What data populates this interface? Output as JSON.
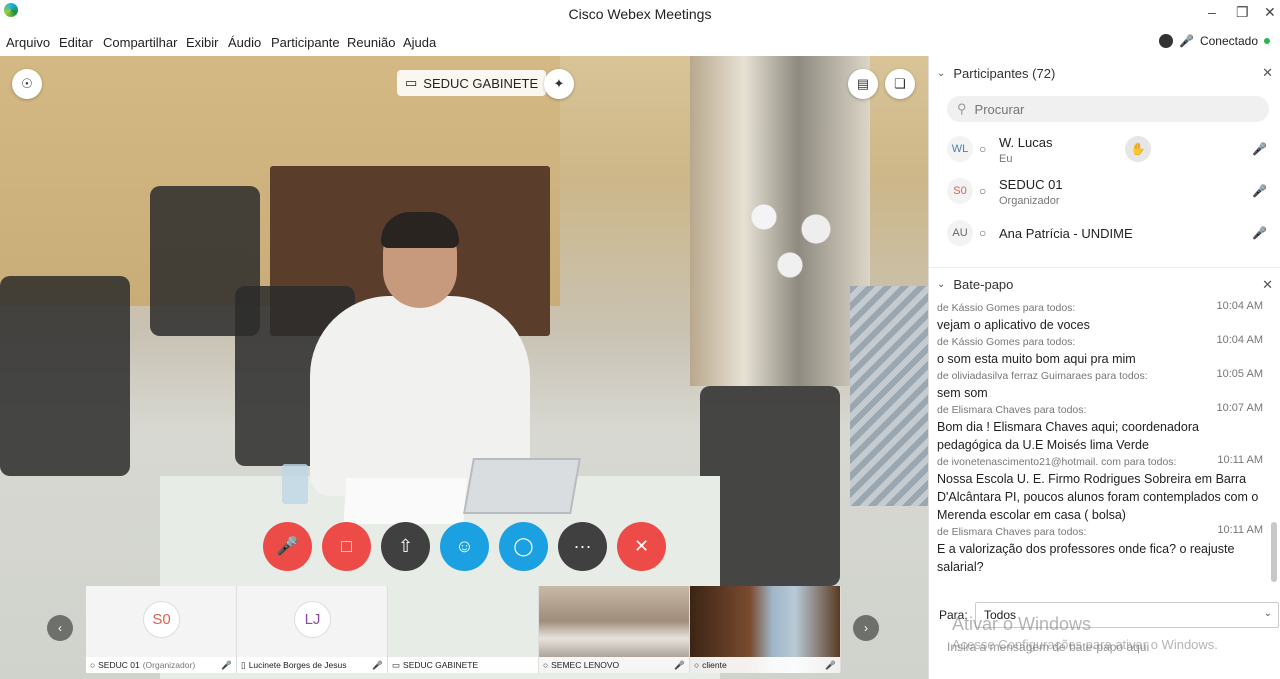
{
  "window": {
    "title": "Cisco Webex Meetings"
  },
  "menu": [
    "Arquivo",
    "Editar",
    "Compartilhar",
    "Exibir",
    "Áudio",
    "Participante",
    "Reunião",
    "Ajuda"
  ],
  "status": {
    "label": "Conectado"
  },
  "video": {
    "presenter_label": "SEDUC GABINETE"
  },
  "thumbnails": [
    {
      "initials": "S0",
      "name": "SEDUC 01",
      "role": "(Organizador)"
    },
    {
      "initials": "LJ",
      "name": "Lucinete Borges de Jesus",
      "role": ""
    },
    {
      "initials": "",
      "name": "SEDUC GABINETE",
      "role": ""
    },
    {
      "initials": "",
      "name": "SEMEC LENOVO",
      "role": ""
    },
    {
      "initials": "",
      "name": "cliente",
      "role": ""
    }
  ],
  "participants": {
    "header": "Participantes (72)",
    "search_placeholder": "Procurar",
    "rows": [
      {
        "initials": "WL",
        "name": "W. Lucas",
        "role": "Eu"
      },
      {
        "initials": "S0",
        "name": "SEDUC 01",
        "role": "Organizador"
      },
      {
        "initials": "AU",
        "name": "Ana Patrícia - UNDIME",
        "role": ""
      }
    ]
  },
  "chat": {
    "header": "Bate-papo",
    "messages": [
      {
        "from": "de Kássio Gomes para todos:",
        "time": "10:04 AM",
        "text": "vejam o aplicativo de voces"
      },
      {
        "from": "de Kássio Gomes para todos:",
        "time": "10:04 AM",
        "text": "o som esta muito bom aqui pra mim"
      },
      {
        "from": "de oliviadasilva ferraz Guimaraes para todos:",
        "time": "10:05 AM",
        "text": "sem som"
      },
      {
        "from": "de Elismara Chaves para todos:",
        "time": "10:07 AM",
        "text": "Bom dia ! Elismara Chaves aqui; coordenadora pedagógica da U.E Moisés lima Verde"
      },
      {
        "from": "de ivonetenascimento21@hotmail. com para todos:",
        "time": "10:11 AM",
        "text": "Nossa Escola U. E. Firmo Rodrigues Sobreira em Barra D'Alcântara PI, poucos alunos foram contemplados com o Merenda escolar em casa ( bolsa)"
      },
      {
        "from": "de Elismara Chaves para todos:",
        "time": "10:11 AM",
        "text": "E a valorização dos professores onde fica? o reajuste salarial?"
      }
    ],
    "to_label": "Para:",
    "to_value": "Todos",
    "input_placeholder": "Insira a mensagem de bate-papo aqui"
  },
  "watermark": {
    "line1": "Ativar o Windows",
    "line2": "Acesse Configurações para ativar o Windows."
  }
}
